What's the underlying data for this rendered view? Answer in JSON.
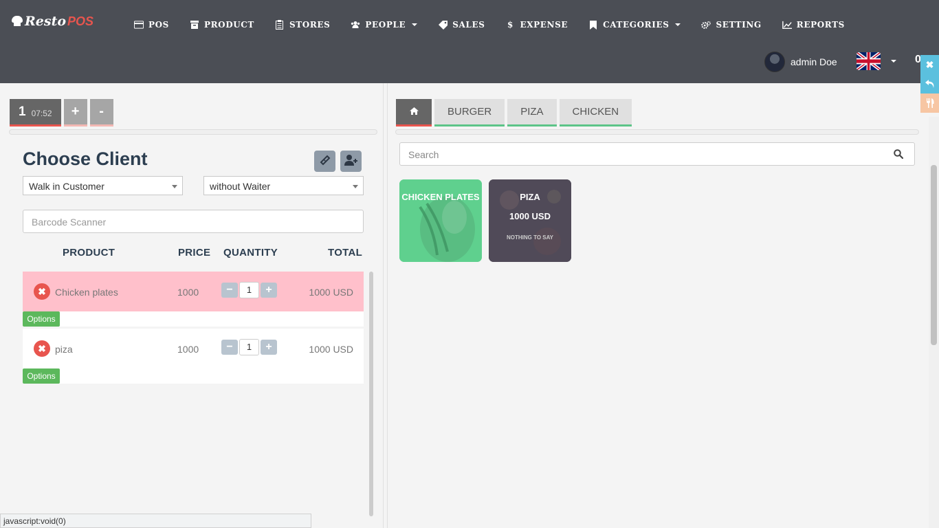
{
  "brand": {
    "name": "Resto",
    "accent": "POS"
  },
  "nav": {
    "pos": "POS",
    "product": "PRODUCT",
    "stores": "STORES",
    "people": "PEOPLE",
    "sales": "SALES",
    "expense": "EXPENSE",
    "categories": "CATEGORIES",
    "setting": "SETTING",
    "reports": "REPORTS"
  },
  "user": {
    "name": "admin Doe",
    "language_flag": "uk-flag-icon",
    "extra": "0"
  },
  "tickets": {
    "active_number": "1",
    "active_time": "07:52",
    "add_label": "+",
    "remove_label": "-"
  },
  "client": {
    "title": "Choose Client",
    "customer_selected": "Walk in Customer",
    "waiter_selected": "without Waiter",
    "barcode_placeholder": "Barcode Scanner"
  },
  "cart": {
    "headers": {
      "product": "PRODUCT",
      "price": "PRICE",
      "quantity": "QUANTITY",
      "total": "TOTAL"
    },
    "rows": [
      {
        "name": "Chicken plates",
        "price": "1000",
        "qty": "1",
        "total": "1000 USD",
        "options": "Options"
      },
      {
        "name": "piza",
        "price": "1000",
        "qty": "1",
        "total": "1000 USD",
        "options": "Options"
      }
    ]
  },
  "categories": {
    "tabs": [
      "BURGER",
      "PIZA",
      "CHICKEN"
    ]
  },
  "search": {
    "placeholder": "Search"
  },
  "products": [
    {
      "name": "CHICKEN PLATES"
    },
    {
      "name": "PIZA",
      "price": "1000 USD",
      "description": "NOTHING TO SAY"
    }
  ],
  "status_bar": {
    "text": "javascript:void(0)"
  },
  "colors": {
    "navbar": "#4b4e55",
    "accent_red": "#e8554e",
    "accent_green": "#5cc488",
    "options_green": "#5cb85c",
    "selected_row": "#ffc0cb",
    "tool_cyan": "#5bc0de",
    "tool_peach": "#f7c6a3"
  }
}
